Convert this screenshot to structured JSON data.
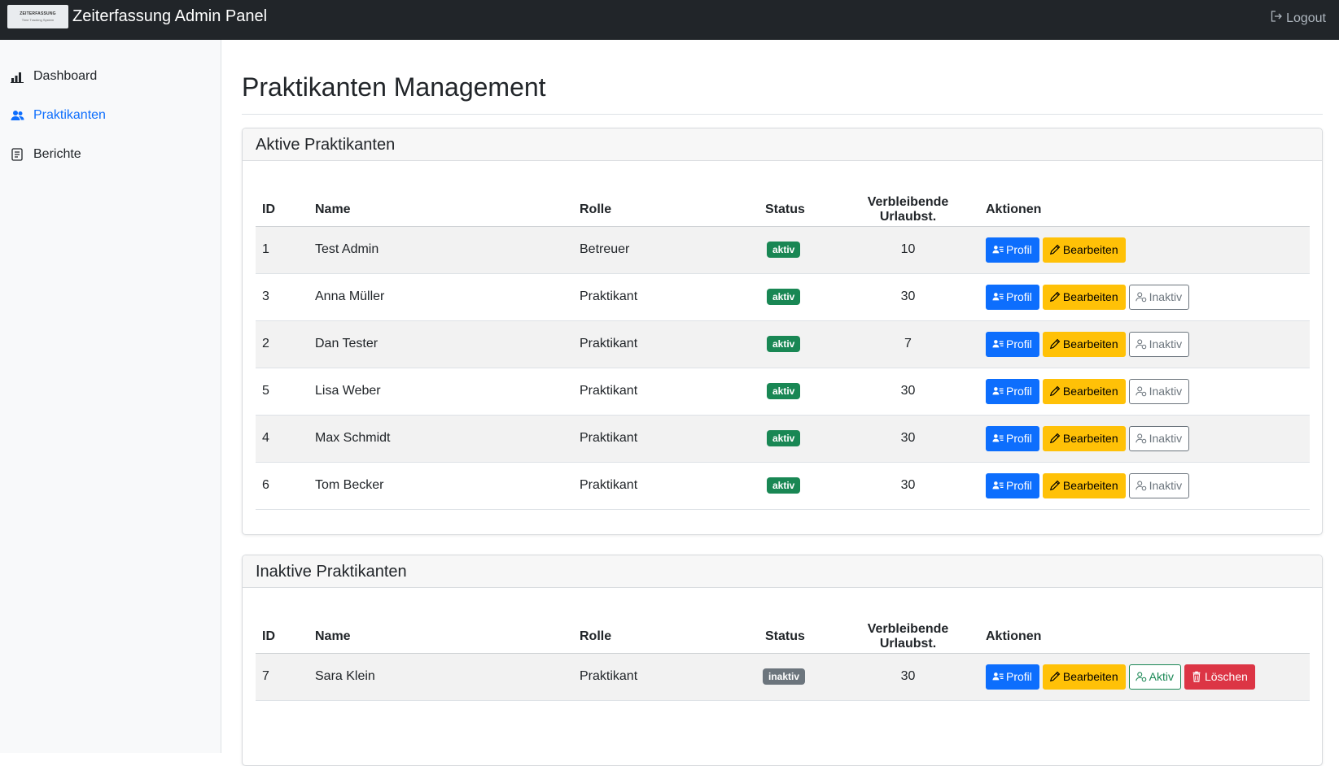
{
  "topbar": {
    "logo_line1": "ZEITERFASSUNG",
    "logo_line2": "Time Tracking System",
    "title": "Zeiterfassung Admin Panel",
    "logout_label": "Logout"
  },
  "sidebar": {
    "items": [
      {
        "label": "Dashboard",
        "icon": "bar-chart-icon"
      },
      {
        "label": "Praktikanten",
        "icon": "people-icon",
        "active": true
      },
      {
        "label": "Berichte",
        "icon": "document-icon"
      }
    ]
  },
  "page": {
    "title": "Praktikanten Management"
  },
  "columns": {
    "id": "ID",
    "name": "Name",
    "rolle": "Rolle",
    "status": "Status",
    "urlaub": "Verbleibende Urlaubst.",
    "aktionen": "Aktionen"
  },
  "buttons": {
    "profil": "Profil",
    "bearbeiten": "Bearbeiten",
    "inaktiv": "Inaktiv",
    "aktiv": "Aktiv",
    "loeschen": "Löschen"
  },
  "active_card": {
    "header": "Aktive Praktikanten",
    "rows": [
      {
        "id": "1",
        "name": "Test Admin",
        "rolle": "Betreuer",
        "status": "aktiv",
        "urlaub": "10"
      },
      {
        "id": "3",
        "name": "Anna Müller",
        "rolle": "Praktikant",
        "status": "aktiv",
        "urlaub": "30"
      },
      {
        "id": "2",
        "name": "Dan Tester",
        "rolle": "Praktikant",
        "status": "aktiv",
        "urlaub": "7"
      },
      {
        "id": "5",
        "name": "Lisa Weber",
        "rolle": "Praktikant",
        "status": "aktiv",
        "urlaub": "30"
      },
      {
        "id": "4",
        "name": "Max Schmidt",
        "rolle": "Praktikant",
        "status": "aktiv",
        "urlaub": "30"
      },
      {
        "id": "6",
        "name": "Tom Becker",
        "rolle": "Praktikant",
        "status": "aktiv",
        "urlaub": "30"
      }
    ]
  },
  "inactive_card": {
    "header": "Inaktive Praktikanten",
    "rows": [
      {
        "id": "7",
        "name": "Sara Klein",
        "rolle": "Praktikant",
        "status": "inaktiv",
        "urlaub": "30"
      }
    ]
  },
  "colors": {
    "primary": "#0d6efd",
    "warning": "#ffc107",
    "success": "#198754",
    "danger": "#dc3545",
    "secondary": "#6c757d",
    "navbar": "#212529"
  }
}
